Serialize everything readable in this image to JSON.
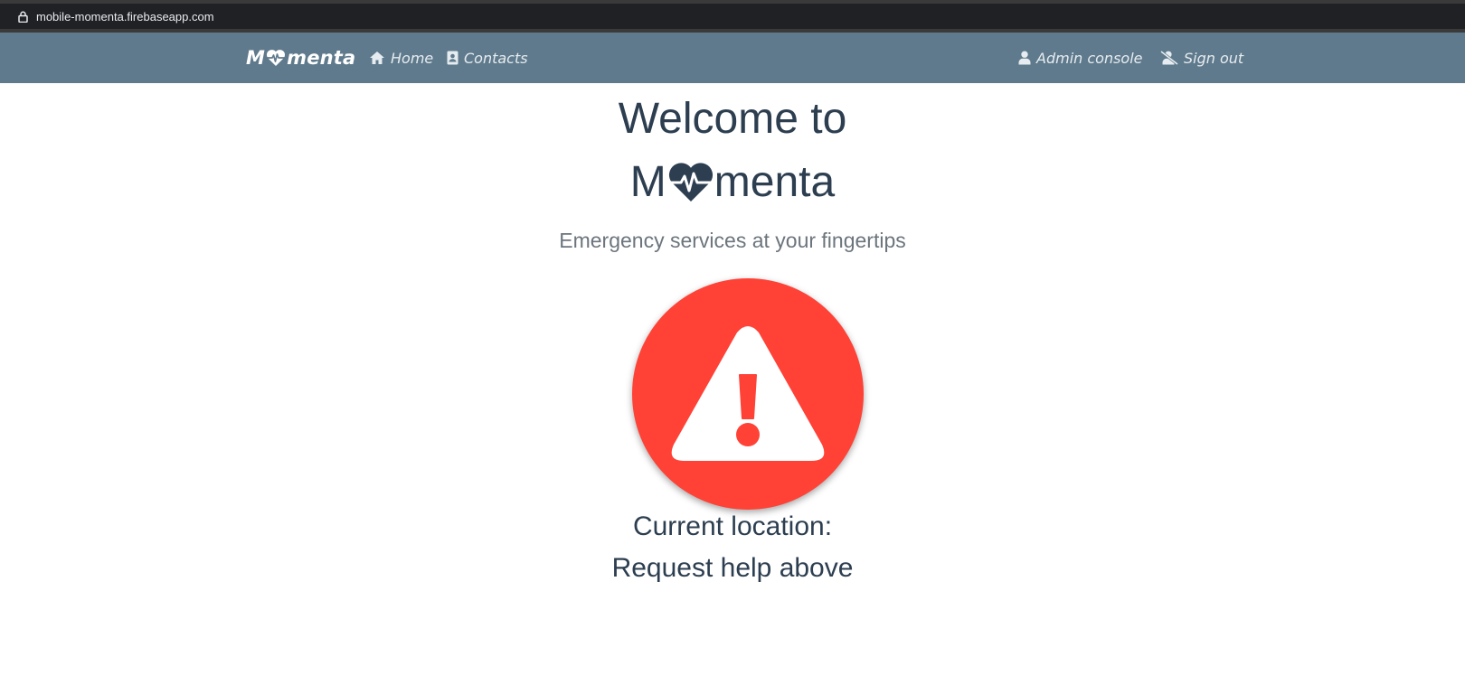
{
  "browser": {
    "url": "mobile-momenta.firebaseapp.com",
    "lock_icon": "lock-icon"
  },
  "navbar": {
    "brand_left": "M",
    "brand_right": "menta",
    "brand_icon": "heart-pulse-icon",
    "links": [
      {
        "label": "Home",
        "icon": "home-icon"
      },
      {
        "label": "Contacts",
        "icon": "address-book-icon"
      }
    ],
    "right_links": [
      {
        "label": "Admin console",
        "icon": "user-icon"
      },
      {
        "label": "Sign out",
        "icon": "user-slash-icon"
      }
    ],
    "colors": {
      "background": "#5f7a8c",
      "text": "#ffffff"
    }
  },
  "main": {
    "heading_line1": "Welcome to",
    "heading_brand_left": "M",
    "heading_brand_right": "menta",
    "heading_icon": "heart-pulse-icon",
    "tagline": "Emergency services at your fingertips",
    "alert_button_icon": "warning-triangle-icon",
    "location_label": "Current location:",
    "location_value": "Request help above",
    "colors": {
      "alert": "#ff4136",
      "heading": "#2c3e50",
      "tagline": "#6c757d"
    }
  }
}
